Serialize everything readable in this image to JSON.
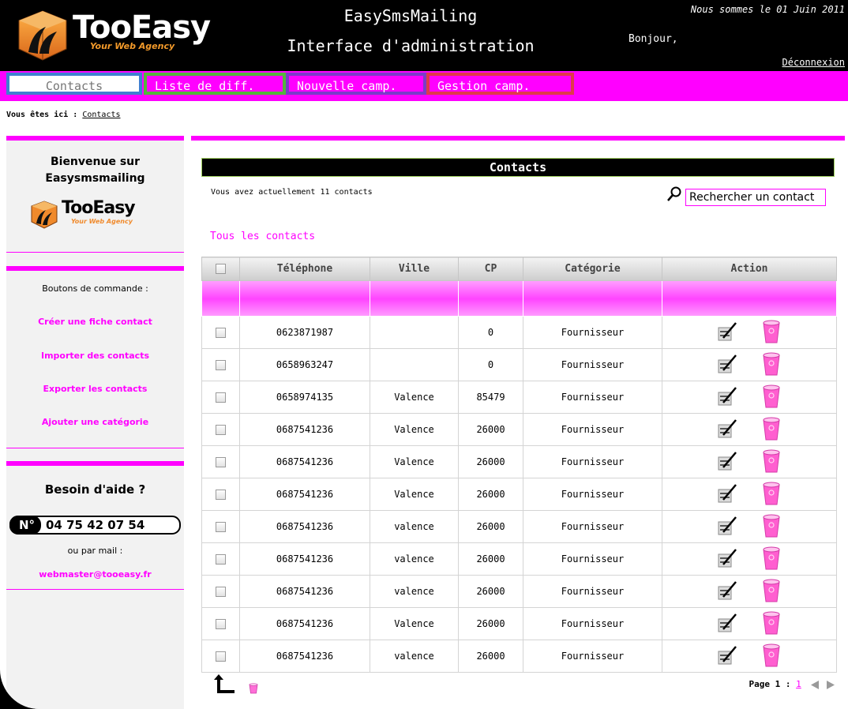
{
  "header": {
    "logo_text": "TooEasy",
    "logo_tagline": "Your Web Agency",
    "app_title": "EasySmsMailing",
    "app_subtitle": "Interface d'administration",
    "date_text": "Nous sommes le 01 Juin 2011",
    "greeting": "Bonjour,",
    "logout_label": "Déconnexion"
  },
  "nav": {
    "tabs": [
      {
        "label": "Contacts"
      },
      {
        "label": "Liste de diff."
      },
      {
        "label": "Nouvelle camp."
      },
      {
        "label": "Gestion camp."
      }
    ]
  },
  "breadcrumb": {
    "prefix": "Vous êtes ici :",
    "current": "Contacts"
  },
  "sidebar": {
    "welcome": "Bienvenue sur Easysmsmailing",
    "commands_title": "Boutons de commande :",
    "links": [
      {
        "label": "Créer une fiche contact"
      },
      {
        "label": "Importer des contacts"
      },
      {
        "label": "Exporter les contacts"
      },
      {
        "label": "Ajouter une catégorie"
      }
    ],
    "help_title": "Besoin d'aide ?",
    "phone_badge": "N°",
    "phone": "04 75 42 07 54",
    "or_mail": "ou par mail :",
    "email": "webmaster@tooeasy.fr"
  },
  "main": {
    "panel_title": "Contacts",
    "count_text": "Vous avez actuellement 11 contacts",
    "search_value": "Rechercher un contact",
    "section_title": "Tous les contacts",
    "columns": [
      "Téléphone",
      "Ville",
      "CP",
      "Catégorie",
      "Action"
    ],
    "rows": [
      {
        "phone": "0623871987",
        "city": "",
        "cp": "0",
        "category": "Fournisseur"
      },
      {
        "phone": "0658963247",
        "city": "",
        "cp": "0",
        "category": "Fournisseur"
      },
      {
        "phone": "0658974135",
        "city": "Valence",
        "cp": "85479",
        "category": "Fournisseur"
      },
      {
        "phone": "0687541236",
        "city": "Valence",
        "cp": "26000",
        "category": "Fournisseur"
      },
      {
        "phone": "0687541236",
        "city": "Valence",
        "cp": "26000",
        "category": "Fournisseur"
      },
      {
        "phone": "0687541236",
        "city": "Valence",
        "cp": "26000",
        "category": "Fournisseur"
      },
      {
        "phone": "0687541236",
        "city": "valence",
        "cp": "26000",
        "category": "Fournisseur"
      },
      {
        "phone": "0687541236",
        "city": "valence",
        "cp": "26000",
        "category": "Fournisseur"
      },
      {
        "phone": "0687541236",
        "city": "valence",
        "cp": "26000",
        "category": "Fournisseur"
      },
      {
        "phone": "0687541236",
        "city": "Valence",
        "cp": "26000",
        "category": "Fournisseur"
      },
      {
        "phone": "0687541236",
        "city": "valence",
        "cp": "26000",
        "category": "Fournisseur"
      }
    ],
    "pager": {
      "label": "Page 1 :",
      "current": "1"
    }
  },
  "colors": {
    "accent": "#ff00ff",
    "tab_contacts_border": "#3f7fd0",
    "tab_lists_border": "#55b43c",
    "tab_new_border": "#7a3cc8",
    "tab_manage_border": "#e03a4a"
  }
}
